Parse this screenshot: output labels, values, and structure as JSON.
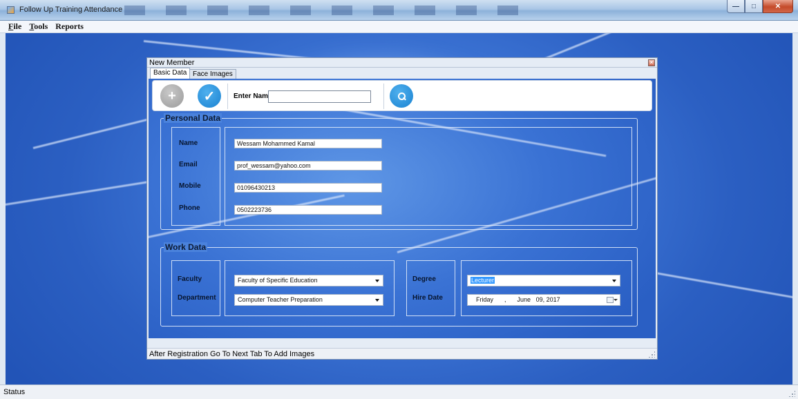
{
  "app": {
    "title": "Follow Up Training Attendance"
  },
  "menu": [
    {
      "label": "File",
      "accel": "F",
      "rest": "ile"
    },
    {
      "label": "Tools",
      "accel": "T",
      "rest": "ools"
    },
    {
      "label": "Reports",
      "accel": "",
      "rest": "Reports"
    }
  ],
  "child_window": {
    "title": "New Member",
    "tabs": [
      "Basic Data",
      "Face Images"
    ],
    "active_tab": "Basic Data",
    "toolbar": {
      "enter_name_label": "Enter Name",
      "enter_name_value": ""
    },
    "personal": {
      "title": "Personal Data",
      "fields": [
        {
          "label": "Name",
          "value": "Wessam Mohammed Kamal"
        },
        {
          "label": "Email",
          "value": "prof_wessam@yahoo.com"
        },
        {
          "label": "Mobile",
          "value": "01096430213"
        },
        {
          "label": "Phone",
          "value": "0502223736"
        }
      ]
    },
    "work": {
      "title": "Work Data",
      "faculty_label": "Faculty",
      "faculty_value": "Faculty  of Specific Education",
      "department_label": "Department",
      "department_value": "Computer Teacher Preparation",
      "degree_label": "Degree",
      "degree_value": "Lecturer",
      "hire_label": "Hire Date",
      "hire_day": "Friday",
      "hire_sep": ",",
      "hire_month": "June",
      "hire_date": "09, 2017"
    },
    "hint": "After Registration Go To Next Tab To Add Images"
  },
  "status": {
    "text": "Status"
  },
  "colors": {
    "accent_blue": "#1a82d1",
    "desktop": "#3a71d2",
    "selection": "#3399ff"
  },
  "icons": {
    "add": "plus-icon",
    "save": "check-icon",
    "search": "search-icon"
  }
}
